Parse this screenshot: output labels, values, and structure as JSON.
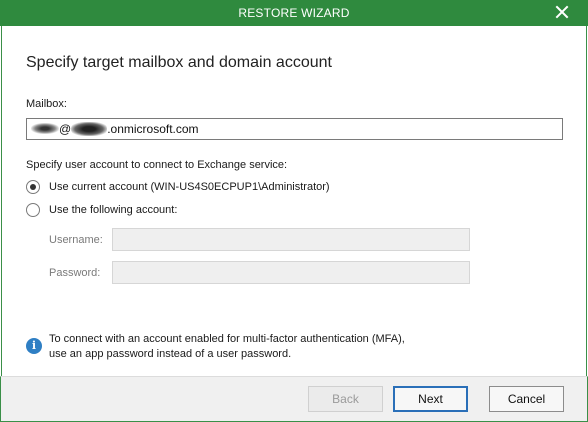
{
  "window": {
    "title": "RESTORE WIZARD",
    "close_icon": "close-icon"
  },
  "page": {
    "heading": "Specify target mailbox and domain account"
  },
  "mailbox": {
    "label": "Mailbox:",
    "value_visible_part_1": "@",
    "value_visible_part_2": ".onmicrosoft.com"
  },
  "account": {
    "section_label": "Specify user account to connect to Exchange service:",
    "options": [
      {
        "label": "Use current account (WIN-US4S0ECPUP1\\Administrator)",
        "selected": true
      },
      {
        "label": "Use the following account:",
        "selected": false
      }
    ],
    "username_label": "Username:",
    "username_value": "",
    "password_label": "Password:",
    "password_value": ""
  },
  "info": {
    "icon": "info-icon",
    "line1": "To connect with an account enabled for multi-factor authentication (MFA),",
    "line2": "use an app password instead of a user password."
  },
  "footer": {
    "back_label": "Back",
    "next_label": "Next",
    "cancel_label": "Cancel"
  },
  "colors": {
    "titlebar": "#2f8a3e",
    "info_icon": "#2f7fc4",
    "primary_button_border": "#2a6fb8"
  }
}
